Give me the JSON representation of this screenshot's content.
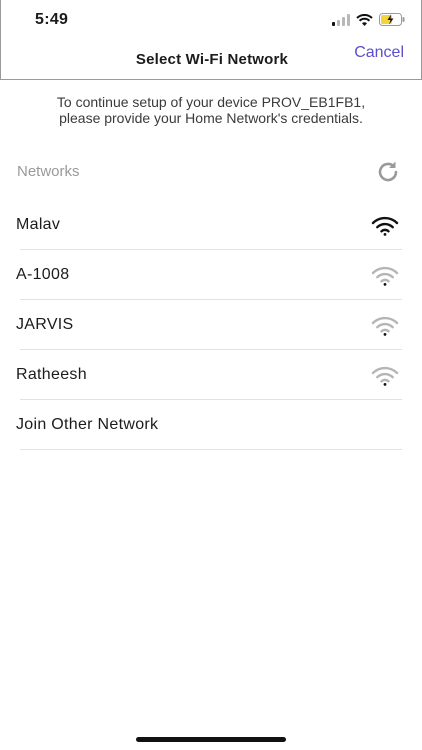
{
  "status_bar": {
    "time": "5:49",
    "icons": [
      "cellular-signal-icon",
      "wifi-icon",
      "battery-charging-icon"
    ]
  },
  "nav": {
    "title": "Select Wi-Fi Network",
    "cancel_label": "Cancel"
  },
  "instructions": "To continue setup of your device PROV_EB1FB1, please provide your Home Network's credentials.",
  "networks_section": {
    "label": "Networks",
    "refresh_icon": "refresh-icon"
  },
  "networks": [
    {
      "ssid": "Malav",
      "signal": "strong"
    },
    {
      "ssid": "A-1008",
      "signal": "weak"
    },
    {
      "ssid": "JARVIS",
      "signal": "weak"
    },
    {
      "ssid": "Ratheesh",
      "signal": "weak"
    }
  ],
  "join_other_label": "Join Other Network",
  "colors": {
    "accent": "#5b4fc9",
    "signal_strong": "#111111",
    "signal_weak": "#b5b5b5",
    "battery_charge": "#f5d33b"
  }
}
